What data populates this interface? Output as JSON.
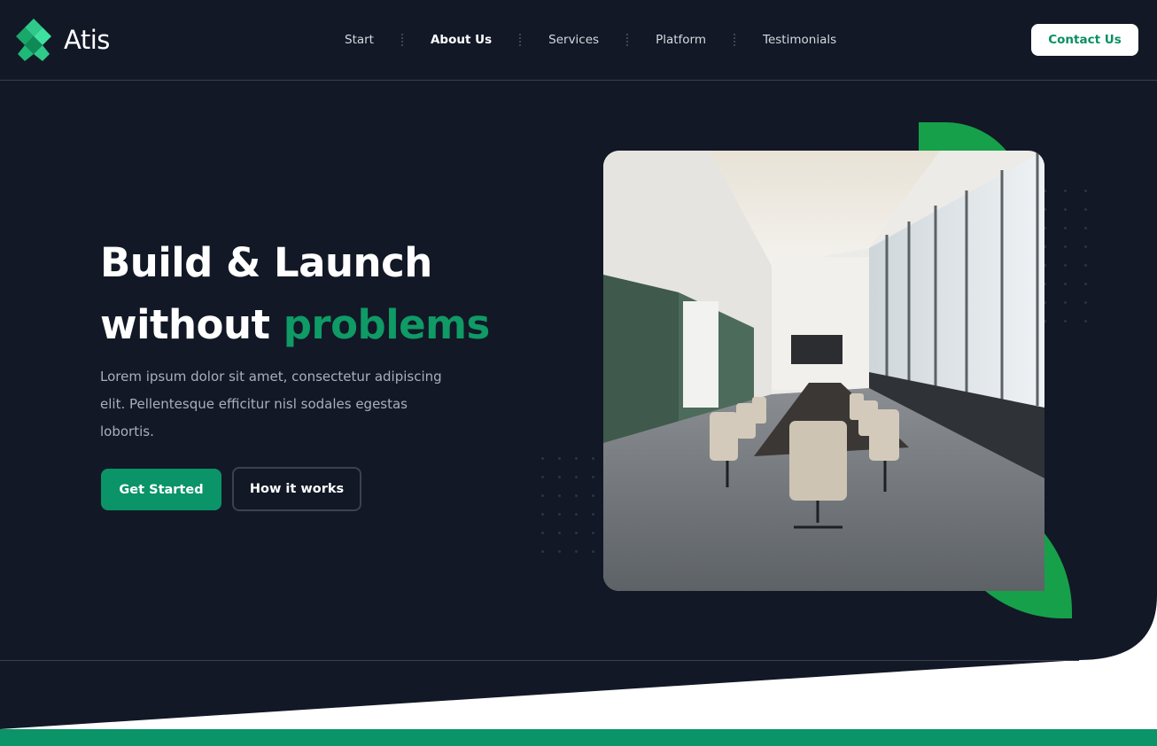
{
  "brand": {
    "name": "Atis",
    "accent_color": "#0a9467",
    "background_color": "#121826",
    "logo_icon": "diamond-grid-icon"
  },
  "nav": {
    "items": [
      {
        "label": "Start",
        "active": false
      },
      {
        "label": "About Us",
        "active": true
      },
      {
        "label": "Services",
        "active": false
      },
      {
        "label": "Platform",
        "active": false
      },
      {
        "label": "Testimonials",
        "active": false
      }
    ],
    "contact_label": "Contact Us"
  },
  "hero": {
    "title_line1": "Build & Launch",
    "title_line2_plain": "without ",
    "title_line2_accent": "problems",
    "description": "Lorem ipsum dolor sit amet, consectetur adipiscing elit. Pellentesque efficitur nisl sodales egestas lobortis.",
    "primary_button": "Get Started",
    "secondary_button": "How it works",
    "image_subject": "conference-room-photo"
  }
}
